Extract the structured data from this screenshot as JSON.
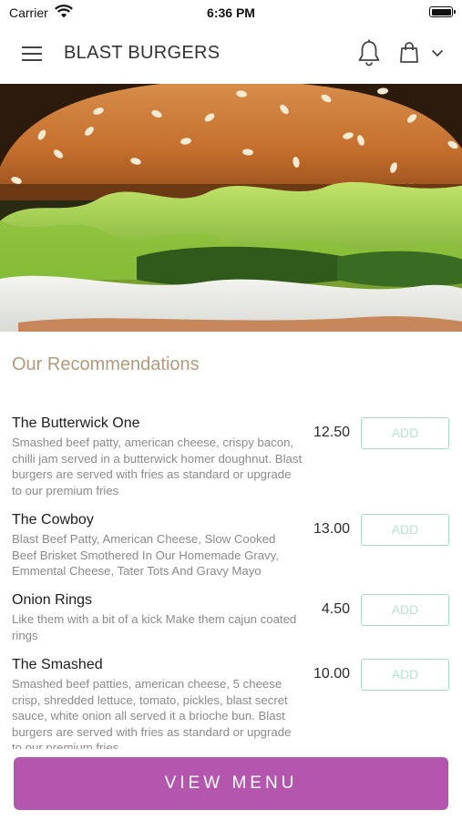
{
  "status_bar": {
    "carrier": "Carrier",
    "time": "6:36 PM"
  },
  "header": {
    "title": "BLAST BURGERS"
  },
  "hero": {
    "image": "burger-photo"
  },
  "section": {
    "title": "Our Recommendations"
  },
  "menu_items": [
    {
      "name": "The Butterwick One",
      "description": "Smashed beef patty, american cheese, crispy bacon, chilli jam served in a butterwick homer doughnut. Blast burgers are served with fries as standard or upgrade to our premium fries",
      "price": "12.50",
      "add_label": "ADD"
    },
    {
      "name": "The Cowboy",
      "description": "Blast Beef Patty, American Cheese, Slow Cooked Beef Brisket Smothered In Our Homemade Gravy, Emmental Cheese, Tater Tots And Gravy Mayo",
      "price": "13.00",
      "add_label": "ADD"
    },
    {
      "name": "Onion Rings",
      "description": "Like them with a bit of a kick Make them cajun coated rings",
      "price": "4.50",
      "add_label": "ADD"
    },
    {
      "name": "The Smashed",
      "description": "Smashed beef patties, american cheese, 5 cheese crisp, shredded lettuce, tomato, pickles, blast secret sauce, white onion all served it a brioche bun. Blast burgers are served with fries as standard or upgrade to our premium fries",
      "price": "10.00",
      "add_label": "ADD"
    }
  ],
  "footer": {
    "view_menu_label": "VIEW MENU"
  },
  "colors": {
    "accent": "#b456ad",
    "section_title": "#b49a7c",
    "add_border": "#a8dcc3",
    "add_text": "#b9e3cf"
  }
}
